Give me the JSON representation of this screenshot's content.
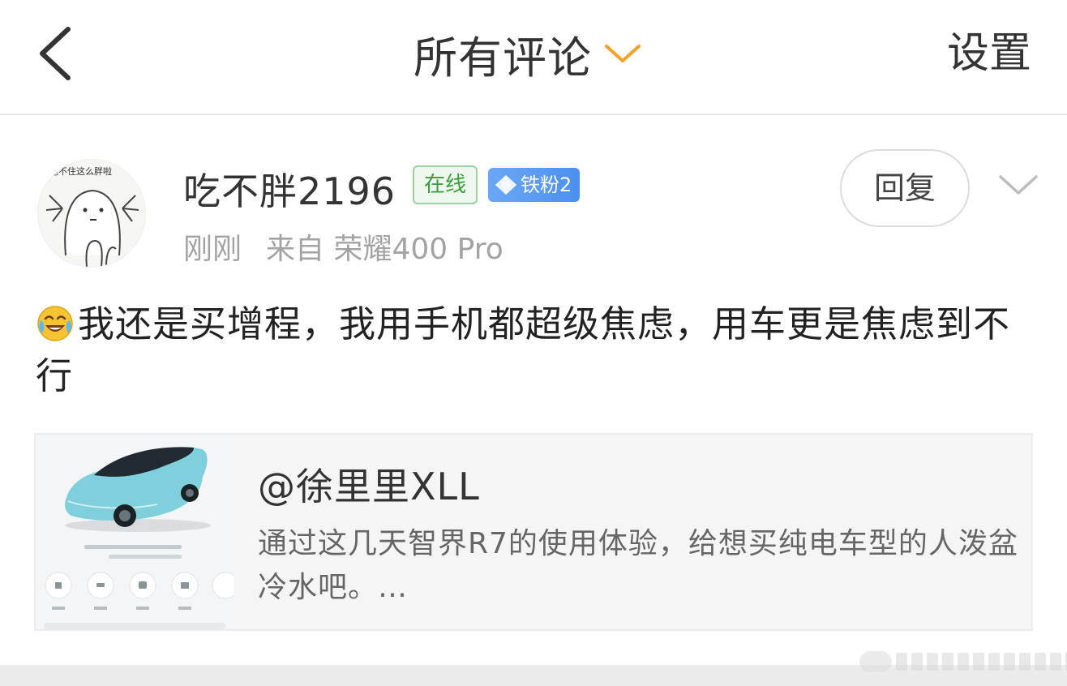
{
  "header": {
    "title": "所有评论",
    "settings_label": "设置",
    "accent_color": "#f5a12a"
  },
  "comment": {
    "avatar_caption": "抱不住这么胖啦",
    "username": "吃不胖2196",
    "online_badge": "在线",
    "fan_badge": "铁粉2",
    "time": "刚刚",
    "source": "来自 荣耀400 Pro",
    "reply_label": "回复",
    "emoji": "laughing-crying-emoji",
    "text": "我还是买增程，我用手机都超级焦虑，用车更是焦虑到不行"
  },
  "repost": {
    "author": "@徐里里XLL",
    "text": "通过这几天智界R7的使用体验，给想买纯电车型的人泼盆冷水吧。…"
  }
}
